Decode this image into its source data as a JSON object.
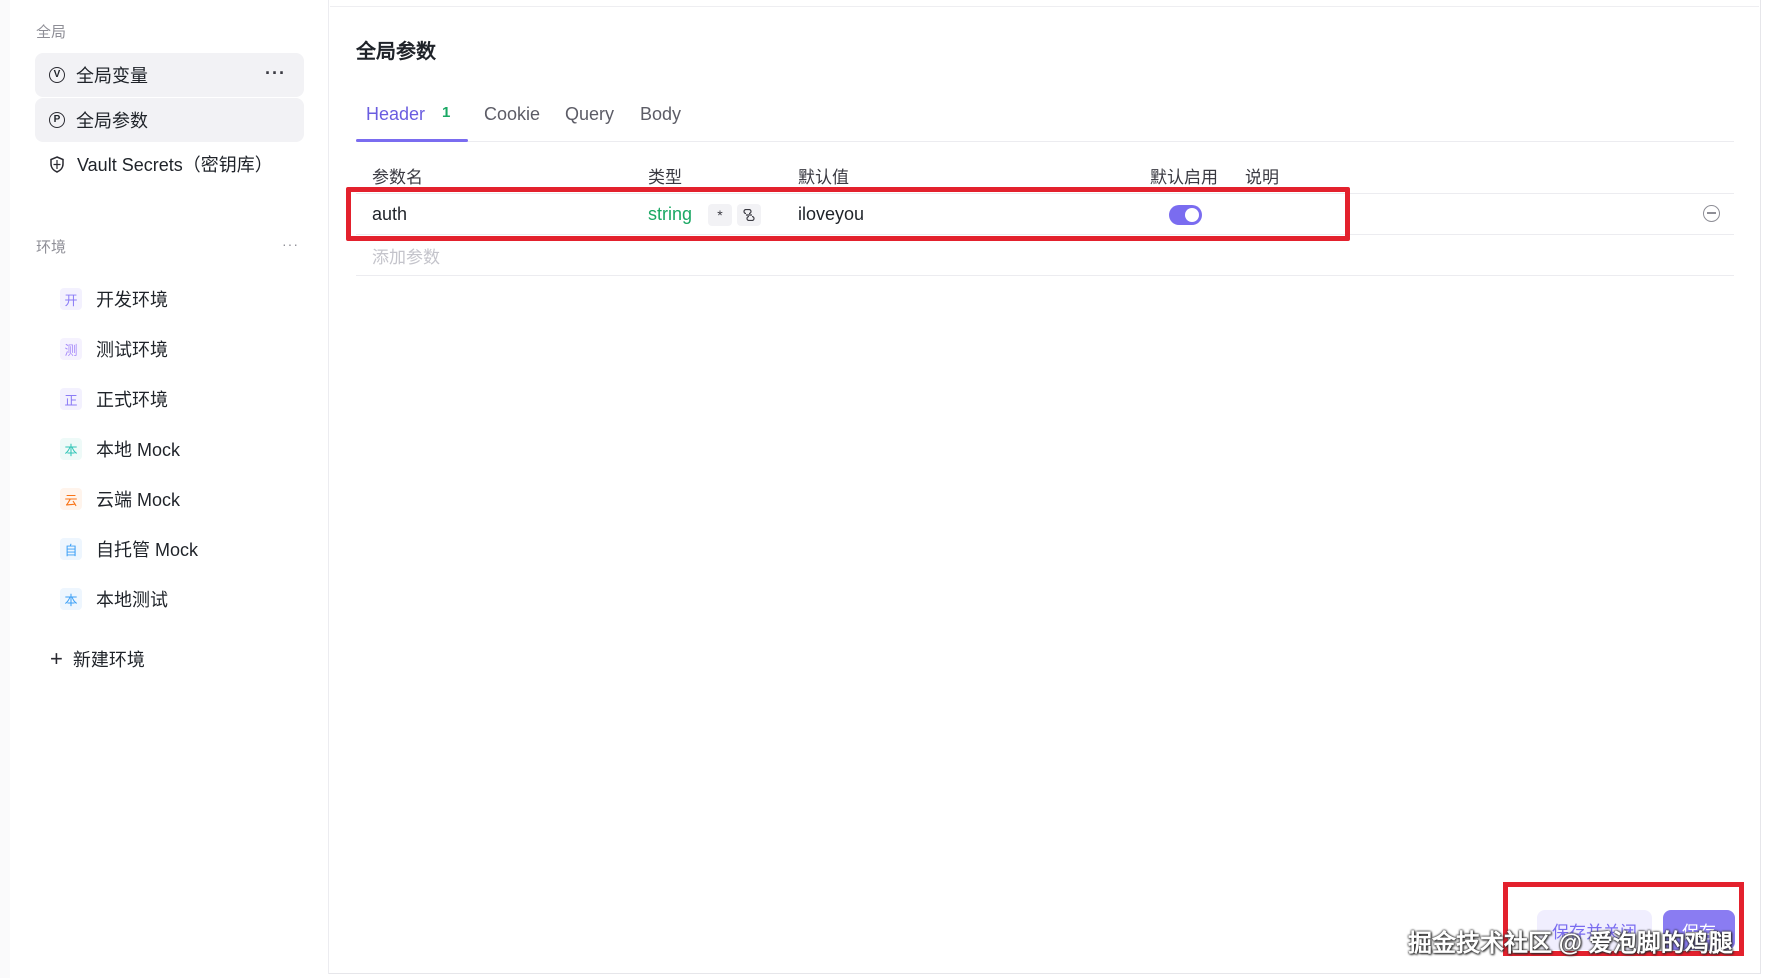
{
  "sidebar": {
    "global_section_label": "全局",
    "global_items": [
      {
        "icon": "V",
        "label": "全局变量",
        "more": "···"
      },
      {
        "icon": "P",
        "label": "全局参数"
      },
      {
        "icon": "shield-icon",
        "label": "Vault Secrets（密钥库）"
      }
    ],
    "env_section_label": "环境",
    "env_more": "···",
    "environments": [
      {
        "badge": "开",
        "label": "开发环境",
        "color": "#8b7cf6"
      },
      {
        "badge": "测",
        "label": "测试环境",
        "color": "#a78bfa"
      },
      {
        "badge": "正",
        "label": "正式环境",
        "color": "#8b7cf6"
      },
      {
        "badge": "本",
        "label": "本地 Mock",
        "color": "#2ec4b6"
      },
      {
        "badge": "云",
        "label": "云端 Mock",
        "color": "#f97316"
      },
      {
        "badge": "自",
        "label": "自托管 Mock",
        "color": "#3b9ff6"
      },
      {
        "badge": "本",
        "label": "本地测试",
        "color": "#3b9ff6"
      }
    ],
    "new_env_label": "新建环境"
  },
  "main": {
    "title": "全局参数",
    "tabs": [
      {
        "label": "Header",
        "count": "1",
        "active": true
      },
      {
        "label": "Cookie"
      },
      {
        "label": "Query"
      },
      {
        "label": "Body"
      }
    ],
    "columns": [
      "参数名",
      "类型",
      "默认值",
      "默认启用",
      "说明"
    ],
    "rows": [
      {
        "name": "auth",
        "type": "string",
        "chip1": "*",
        "chip2": "link-icon",
        "default": "iloveyou",
        "enabled": true,
        "description": ""
      }
    ],
    "add_param_placeholder": "添加参数"
  },
  "footer": {
    "save_close_label": "保存并关闭",
    "save_label": "保存"
  },
  "watermark": "掘金技术社区 @ 爱泡脚的鸡腿",
  "colors": {
    "accent": "#7a6cf0",
    "type_string": "#1aa864",
    "highlight": "#e3212d"
  }
}
